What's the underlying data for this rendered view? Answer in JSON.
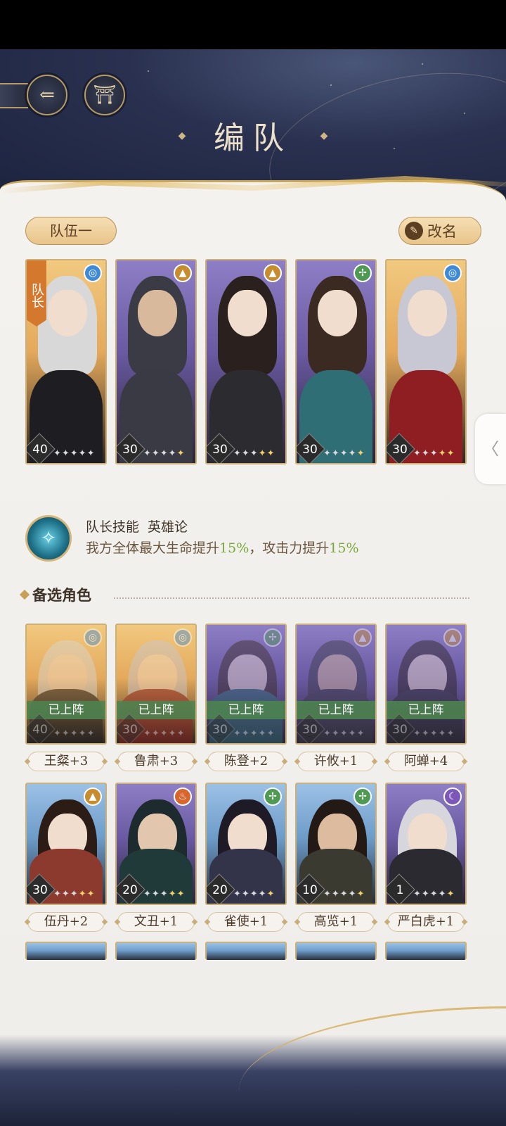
{
  "header": {
    "title": "编队",
    "back_icon": "back-arrow-icon",
    "home_icon": "pavilion-icon"
  },
  "team": {
    "name": "队伍一",
    "rename_label": "改名",
    "captain_label": "队长",
    "members": [
      {
        "level": "40",
        "element": "water",
        "frame": "gold",
        "stars_lit": 0
      },
      {
        "level": "30",
        "element": "earth",
        "frame": "purple",
        "stars_lit": 1
      },
      {
        "level": "30",
        "element": "earth",
        "frame": "purple",
        "stars_lit": 2
      },
      {
        "level": "30",
        "element": "wind",
        "frame": "purple",
        "stars_lit": 1
      },
      {
        "level": "30",
        "element": "water",
        "frame": "gold",
        "stars_lit": 2
      }
    ]
  },
  "skill": {
    "label": "队长技能",
    "name": "英雄论",
    "desc_part1": "我方全体最大生命提升",
    "desc_value1": "15%",
    "desc_part2": "，攻击力提升",
    "desc_value2": "15%"
  },
  "roster": {
    "section_title": "备选角色",
    "deployed_label": "已上阵",
    "rows": [
      [
        {
          "name": "王粲+3",
          "level": "40",
          "element": "water",
          "frame": "gold",
          "deployed": true
        },
        {
          "name": "鲁肃+3",
          "level": "30",
          "element": "water",
          "frame": "gold",
          "deployed": true
        },
        {
          "name": "陈登+2",
          "level": "30",
          "element": "wind",
          "frame": "purple",
          "deployed": true
        },
        {
          "name": "许攸+1",
          "level": "30",
          "element": "earth",
          "frame": "purple",
          "deployed": true
        },
        {
          "name": "阿蝉+4",
          "level": "30",
          "element": "earth",
          "frame": "purple",
          "deployed": true
        }
      ],
      [
        {
          "name": "伍丹+2",
          "level": "30",
          "element": "earth",
          "frame": "blue",
          "deployed": false
        },
        {
          "name": "文丑+1",
          "level": "20",
          "element": "fire",
          "frame": "purple",
          "deployed": false
        },
        {
          "name": "雀使+1",
          "level": "20",
          "element": "wind",
          "frame": "blue",
          "deployed": false
        },
        {
          "name": "高览+1",
          "level": "10",
          "element": "wind",
          "frame": "blue",
          "deployed": false
        },
        {
          "name": "严白虎+1",
          "level": "1",
          "element": "moon",
          "frame": "purple",
          "deployed": false
        }
      ]
    ]
  },
  "colors": {
    "gold": "#cbb07a",
    "panel": "#f2f0ec",
    "highlight_green": "#79a83a",
    "deployed_green": "#4d8450"
  }
}
